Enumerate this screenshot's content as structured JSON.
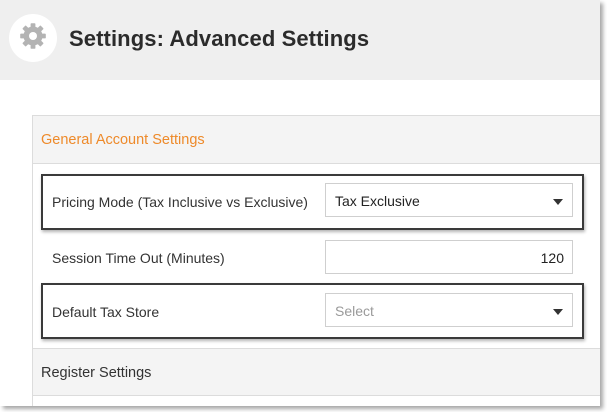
{
  "page": {
    "title": "Settings: Advanced Settings",
    "icon": "gear-icon"
  },
  "sections": {
    "general": {
      "label": "General Account Settings",
      "color": "#ee8a2a"
    },
    "register": {
      "label": "Register Settings"
    }
  },
  "fields": {
    "pricing_mode": {
      "label": "Pricing Mode (Tax Inclusive vs Exclusive)",
      "value": "Tax Exclusive"
    },
    "session_timeout": {
      "label": "Session Time Out (Minutes)",
      "value": "120"
    },
    "default_tax_store": {
      "label": "Default Tax Store",
      "placeholder": "Select"
    }
  }
}
